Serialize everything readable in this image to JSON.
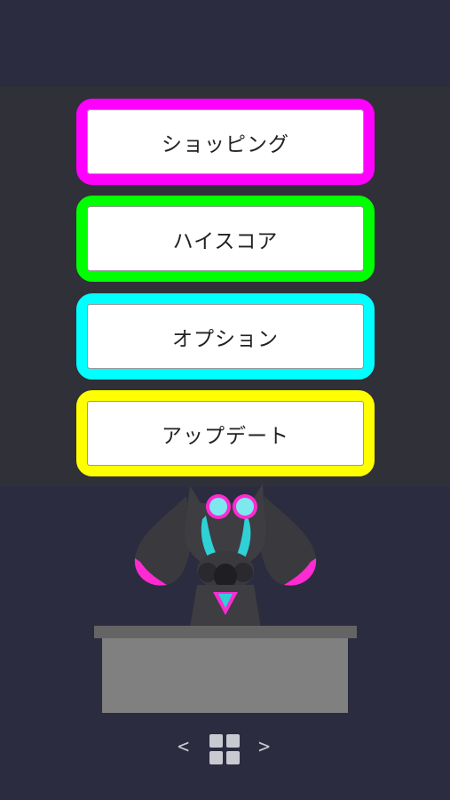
{
  "menu": {
    "shopping_label": "ショッピング",
    "highscore_label": "ハイスコア",
    "options_label": "オプション",
    "update_label": "アップデート"
  },
  "colors": {
    "background": "#2b2c3f",
    "panel": "#303039",
    "shopping_border": "#ff00ff",
    "highscore_border": "#00ff00",
    "options_border": "#00ffff",
    "update_border": "#ffff00",
    "desk_top": "#646464",
    "desk_body": "#808080"
  },
  "nav": {
    "prev_label": "<",
    "next_label": ">",
    "grid_icon": "grid-icon"
  }
}
